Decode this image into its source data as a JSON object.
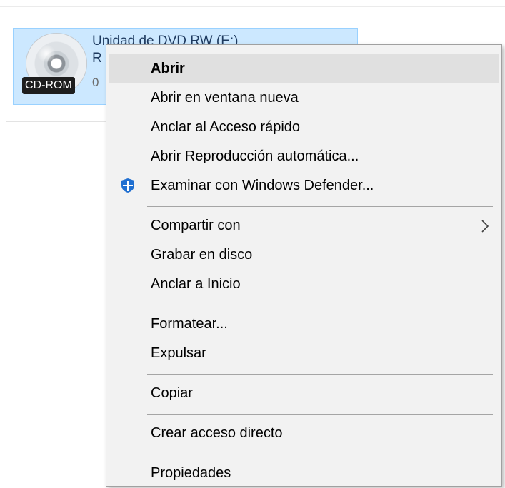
{
  "drive_tile": {
    "name": "Unidad de DVD RW (E:)",
    "line2": "R",
    "line3": "0",
    "badge": "CD-ROM",
    "icon": "cd-disc-icon",
    "highlight_color": "#cce8ff"
  },
  "context_menu": {
    "highlight_color": "#e0e0e0",
    "items": [
      {
        "label": "Abrir",
        "bold": true,
        "highlighted": true
      },
      {
        "label": "Abrir en ventana nueva"
      },
      {
        "label": "Anclar al Acceso rápido"
      },
      {
        "label": "Abrir Reproducción automática..."
      },
      {
        "label": "Examinar con Windows Defender...",
        "icon": "windows-defender-icon"
      },
      {
        "label": "Compartir con",
        "submenu": true,
        "arrow_icon": "chevron-right-icon"
      },
      {
        "label": "Grabar en disco"
      },
      {
        "label": "Anclar a Inicio"
      },
      {
        "label": "Formatear..."
      },
      {
        "label": "Expulsar"
      },
      {
        "label": "Copiar"
      },
      {
        "label": "Crear acceso directo"
      },
      {
        "label": "Propiedades"
      }
    ]
  },
  "colors": {
    "defender_blue": "#1f6fd1",
    "menu_background": "#f2f2f2"
  }
}
